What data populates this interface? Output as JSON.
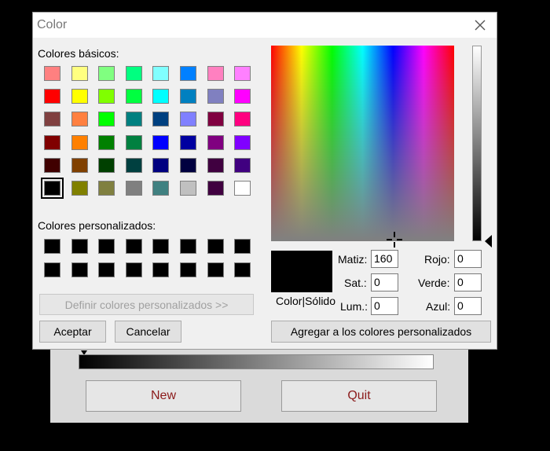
{
  "dialog": {
    "title": "Color",
    "basic_label": "Colores básicos:",
    "custom_label": "Colores personalizados:",
    "basic_colors": [
      [
        "#ff8080",
        "#ffff80",
        "#80ff80",
        "#00ff80",
        "#80ffff",
        "#0080ff",
        "#ff80c0",
        "#ff80ff"
      ],
      [
        "#ff0000",
        "#ffff00",
        "#80ff00",
        "#00ff40",
        "#00ffff",
        "#0080c0",
        "#8080c0",
        "#ff00ff"
      ],
      [
        "#804040",
        "#ff8040",
        "#00ff00",
        "#008080",
        "#004080",
        "#8080ff",
        "#800040",
        "#ff0080"
      ],
      [
        "#800000",
        "#ff8000",
        "#008000",
        "#008040",
        "#0000ff",
        "#0000a0",
        "#800080",
        "#8000ff"
      ],
      [
        "#400000",
        "#804000",
        "#004000",
        "#004040",
        "#000080",
        "#000040",
        "#400040",
        "#400080"
      ],
      [
        "#000000",
        "#808000",
        "#808040",
        "#808080",
        "#408080",
        "#c0c0c0",
        "#400040",
        "#ffffff"
      ]
    ],
    "custom_colors": [
      [
        "#000000",
        "#000000",
        "#000000",
        "#000000",
        "#000000",
        "#000000",
        "#000000",
        "#000000"
      ],
      [
        "#000000",
        "#000000",
        "#000000",
        "#000000",
        "#000000",
        "#000000",
        "#000000",
        "#000000"
      ]
    ],
    "define_custom_label": "Definir colores personalizados >>",
    "ok_label": "Aceptar",
    "cancel_label": "Cancelar",
    "add_custom_label": "Agregar a los colores personalizados",
    "color_solid_label": "Color|Sólido",
    "hue_label": "Matiz:",
    "sat_label": "Sat.:",
    "lum_label": "Lum.:",
    "red_label": "Rojo:",
    "green_label": "Verde:",
    "blue_label": "Azul:",
    "hue_value": "160",
    "sat_value": "0",
    "lum_value": "0",
    "red_value": "0",
    "green_value": "0",
    "blue_value": "0",
    "preview_color": "#000000"
  },
  "background_app": {
    "new_label": "New",
    "quit_label": "Quit"
  }
}
